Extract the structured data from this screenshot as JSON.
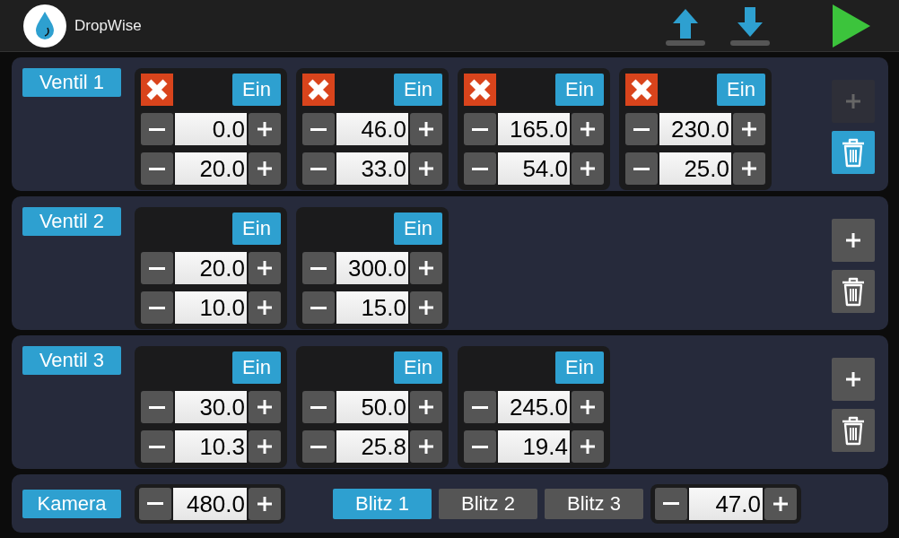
{
  "app": {
    "title": "DropWise"
  },
  "valves": [
    {
      "label": "Ventil 1",
      "add_enabled": false,
      "delete_active": true,
      "steps": [
        {
          "marked": true,
          "toggle": "Ein",
          "values": [
            "0.0",
            "20.0"
          ]
        },
        {
          "marked": true,
          "toggle": "Ein",
          "values": [
            "46.0",
            "33.0"
          ]
        },
        {
          "marked": true,
          "toggle": "Ein",
          "values": [
            "165.0",
            "54.0"
          ]
        },
        {
          "marked": true,
          "toggle": "Ein",
          "values": [
            "230.0",
            "25.0"
          ]
        }
      ]
    },
    {
      "label": "Ventil 2",
      "add_enabled": true,
      "delete_active": false,
      "steps": [
        {
          "marked": false,
          "toggle": "Ein",
          "values": [
            "20.0",
            "10.0"
          ]
        },
        {
          "marked": false,
          "toggle": "Ein",
          "values": [
            "300.0",
            "15.0"
          ]
        }
      ]
    },
    {
      "label": "Ventil 3",
      "add_enabled": true,
      "delete_active": false,
      "steps": [
        {
          "marked": false,
          "toggle": "Ein",
          "values": [
            "30.0",
            "10.3"
          ]
        },
        {
          "marked": false,
          "toggle": "Ein",
          "values": [
            "50.0",
            "25.8"
          ]
        },
        {
          "marked": false,
          "toggle": "Ein",
          "values": [
            "245.0",
            "19.4"
          ]
        }
      ]
    }
  ],
  "camera": {
    "label": "Kamera",
    "value": "480.0",
    "flashes": [
      {
        "label": "Blitz 1",
        "selected": true
      },
      {
        "label": "Blitz 2",
        "selected": false
      },
      {
        "label": "Blitz 3",
        "selected": false
      }
    ],
    "flash_value": "47.0"
  }
}
